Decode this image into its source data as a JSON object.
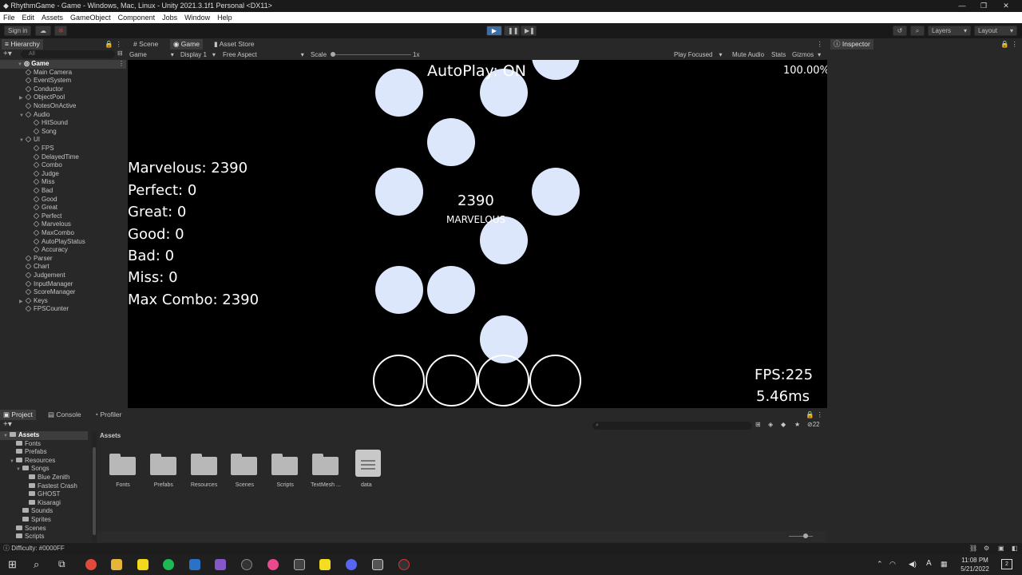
{
  "window": {
    "title": "RhythmGame - Game - Windows, Mac, Linux - Unity 2021.3.1f1 Personal <DX11>",
    "minimize": "—",
    "maximize": "❐",
    "close": "✕"
  },
  "menu": [
    "File",
    "Edit",
    "Assets",
    "GameObject",
    "Component",
    "Jobs",
    "Window",
    "Help"
  ],
  "toolbar": {
    "signin": "Sign in",
    "layers": "Layers",
    "layout": "Layout"
  },
  "hierarchy": {
    "tab": "Hierarchy",
    "search_placeholder": "All",
    "root": "Game",
    "items": [
      {
        "label": "Main Camera",
        "depth": 1
      },
      {
        "label": "EventSystem",
        "depth": 1
      },
      {
        "label": "Conductor",
        "depth": 1
      },
      {
        "label": "ObjectPool",
        "depth": 1
      },
      {
        "label": "NotesOnActive",
        "depth": 1
      },
      {
        "label": "Audio",
        "depth": 1
      },
      {
        "label": "HitSound",
        "depth": 2
      },
      {
        "label": "Song",
        "depth": 2
      },
      {
        "label": "UI",
        "depth": 1
      },
      {
        "label": "FPS",
        "depth": 2
      },
      {
        "label": "DelayedTime",
        "depth": 2
      },
      {
        "label": "Combo",
        "depth": 2
      },
      {
        "label": "Judge",
        "depth": 2
      },
      {
        "label": "Miss",
        "depth": 2
      },
      {
        "label": "Bad",
        "depth": 2
      },
      {
        "label": "Good",
        "depth": 2
      },
      {
        "label": "Great",
        "depth": 2
      },
      {
        "label": "Perfect",
        "depth": 2
      },
      {
        "label": "Marvelous",
        "depth": 2
      },
      {
        "label": "MaxCombo",
        "depth": 2
      },
      {
        "label": "AutoPlayStatus",
        "depth": 2
      },
      {
        "label": "Accuracy",
        "depth": 2
      },
      {
        "label": "Parser",
        "depth": 1
      },
      {
        "label": "Chart",
        "depth": 1
      },
      {
        "label": "Judgement",
        "depth": 1
      },
      {
        "label": "InputManager",
        "depth": 1
      },
      {
        "label": "ScoreManager",
        "depth": 1
      },
      {
        "label": "Keys",
        "depth": 1
      },
      {
        "label": "FPSCounter",
        "depth": 1
      }
    ]
  },
  "view_tabs": {
    "scene": "Scene",
    "game": "Game",
    "asset_store": "Asset Store"
  },
  "game_bar": {
    "mode": "Game",
    "display": "Display 1",
    "aspect": "Free Aspect",
    "scale_label": "Scale",
    "scale_value": "1x",
    "play_focused": "Play Focused",
    "mute": "Mute Audio",
    "stats": "Stats",
    "gizmos": "Gizmos"
  },
  "game": {
    "autoplay": "AutoPlay: ON",
    "accuracy": "100.00%",
    "stats": [
      "Marvelous: 2390",
      "Perfect: 0",
      "Great: 0",
      "Good: 0",
      "Bad: 0",
      "Miss: 0",
      "Max Combo: 2390"
    ],
    "combo": "2390",
    "judge": "MARVELOUS",
    "fps": "FPS:225",
    "ms": "5.46ms"
  },
  "inspector": {
    "tab": "Inspector"
  },
  "bottom_tabs": {
    "project": "Project",
    "console": "Console",
    "profiler": "Profiler"
  },
  "project": {
    "breadcrumb": "Assets",
    "hidden_count": "22",
    "tree": [
      {
        "label": "Assets",
        "depth": 0,
        "bold": true
      },
      {
        "label": "Fonts",
        "depth": 1
      },
      {
        "label": "Prefabs",
        "depth": 1
      },
      {
        "label": "Resources",
        "depth": 1
      },
      {
        "label": "Songs",
        "depth": 2
      },
      {
        "label": "Blue Zenith",
        "depth": 3
      },
      {
        "label": "Fastest Crash",
        "depth": 3
      },
      {
        "label": "GHOST",
        "depth": 3
      },
      {
        "label": "Kisaragi",
        "depth": 3
      },
      {
        "label": "Sounds",
        "depth": 2
      },
      {
        "label": "Sprites",
        "depth": 2
      },
      {
        "label": "Scenes",
        "depth": 1
      },
      {
        "label": "Scripts",
        "depth": 1
      }
    ],
    "assets": [
      "Fonts",
      "Prefabs",
      "Resources",
      "Scenes",
      "Scripts",
      "TextMesh ...",
      "data"
    ]
  },
  "status": {
    "text": "Difficulty: #0000FF"
  },
  "clock": {
    "time": "11:08 PM",
    "date": "5/21/2022",
    "notifications": "2"
  },
  "colors": {
    "note": "#dde7fb",
    "play_accent": "#3c6ea5",
    "panel_bg": "#282828"
  }
}
